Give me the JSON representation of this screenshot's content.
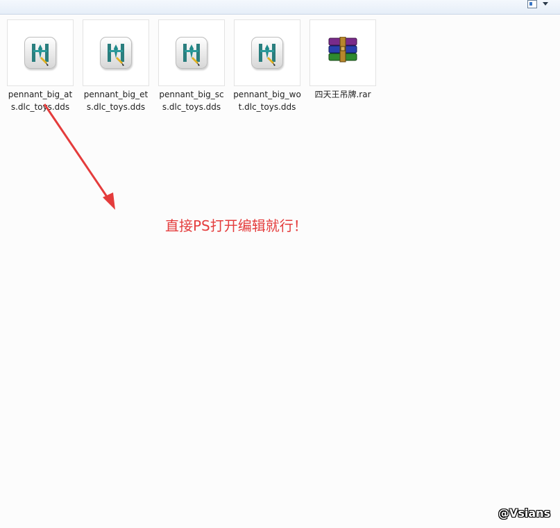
{
  "toolbar": {
    "view_icon": "view-options-icon",
    "caret_icon": "chevron-down-icon"
  },
  "files": [
    {
      "name": "pennant_big_ats.dlc_toys.dds",
      "icon": "dds-image-icon"
    },
    {
      "name": "pennant_big_ets.dlc_toys.dds",
      "icon": "dds-image-icon"
    },
    {
      "name": "pennant_big_scs.dlc_toys.dds",
      "icon": "dds-image-icon"
    },
    {
      "name": "pennant_big_wot.dlc_toys.dds",
      "icon": "dds-image-icon"
    },
    {
      "name": "四天王吊牌.rar",
      "icon": "winrar-archive-icon"
    }
  ],
  "annotation": {
    "text": "直接PS打开编辑就行！",
    "color": "#e43c3c"
  },
  "watermark": {
    "text": "@Vsians"
  }
}
